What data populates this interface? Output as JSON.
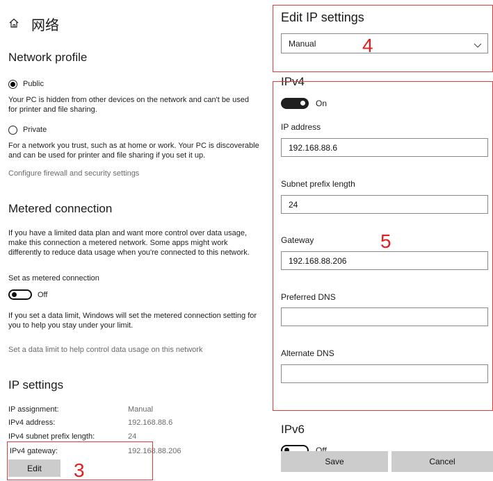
{
  "header": {
    "title": "网络",
    "home_icon": "home-icon"
  },
  "network_profile": {
    "heading": "Network profile",
    "public_label": "Public",
    "public_desc": "Your PC is hidden from other devices on the network and can't be used for printer and file sharing.",
    "private_label": "Private",
    "private_desc": "For a network you trust, such as at home or work. Your PC is discoverable and can be used for printer and file sharing if you set it up.",
    "firewall_link": "Configure firewall and security settings",
    "selected": "Public"
  },
  "metered": {
    "heading": "Metered connection",
    "desc": "If you have a limited data plan and want more control over data usage, make this connection a metered network. Some apps might work differently to reduce data usage when you're connected to this network.",
    "set_label": "Set as metered connection",
    "toggle_state": "Off",
    "limit_desc": "If you set a data limit, Windows will set the metered connection setting for you to help you stay under your limit.",
    "limit_link": "Set a data limit to help control data usage on this network"
  },
  "ip_settings": {
    "heading": "IP settings",
    "rows": [
      {
        "label": "IP assignment:",
        "value": "Manual"
      },
      {
        "label": "IPv4 address:",
        "value": "192.168.88.6"
      },
      {
        "label": "IPv4 subnet prefix length:",
        "value": "24"
      },
      {
        "label": "IPv4 gateway:",
        "value": "192.168.88.206"
      }
    ],
    "edit_button": "Edit"
  },
  "dialog": {
    "title": "Edit IP settings",
    "mode_select": "Manual",
    "ipv4": {
      "heading": "IPv4",
      "toggle_state": "On",
      "ip_address_label": "IP address",
      "ip_address_value": "192.168.88.6",
      "subnet_label": "Subnet prefix length",
      "subnet_value": "24",
      "gateway_label": "Gateway",
      "gateway_value": "192.168.88.206",
      "preferred_dns_label": "Preferred DNS",
      "preferred_dns_value": "",
      "alternate_dns_label": "Alternate DNS",
      "alternate_dns_value": ""
    },
    "ipv6": {
      "heading": "IPv6",
      "toggle_state": "Off"
    },
    "save_button": "Save",
    "cancel_button": "Cancel"
  },
  "annotations": {
    "callout_3": "3",
    "callout_4": "4",
    "callout_5": "5"
  },
  "colors": {
    "annotation_red": "#e03a3a",
    "button_gray": "#cccccc",
    "text_muted": "#6b6b6b"
  }
}
